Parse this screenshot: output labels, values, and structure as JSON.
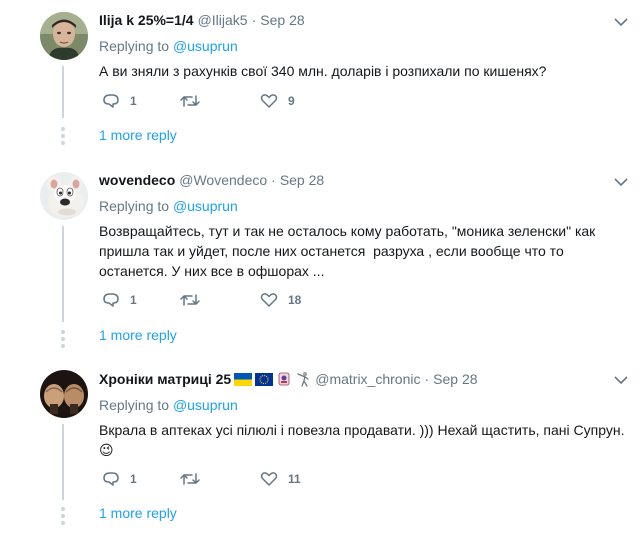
{
  "tweets": [
    {
      "name": "Ilija k 25%=1/4",
      "handle": "@Ilijak5",
      "date": "Sep 28",
      "replying_label": "Replying to",
      "replying_handle": "@usuprun",
      "text": "А ви зняли з рахунків свої 340 млн. доларів і розпихали по кишенях?",
      "replies": "1",
      "retweets": "",
      "likes": "9",
      "more": "1 more reply"
    },
    {
      "name": "wovendeco",
      "handle": "@Wovendeco",
      "date": "Sep 28",
      "replying_label": "Replying to",
      "replying_handle": "@usuprun",
      "text": "Возвращайтесь, тут и так не осталось кому работать, \"моника зеленски\" как пришла так и уйдет, после них останется  разруха , если вообще что то останется. У них все в офшорах ...",
      "replies": "1",
      "retweets": "",
      "likes": "18",
      "more": "1 more reply"
    },
    {
      "name": "Хроніки матриці 25",
      "handle": "@matrix_chronic",
      "date": "Sep 28",
      "replying_label": "Replying to",
      "replying_handle": "@usuprun",
      "text": "Вкрала в аптеках усі пілюлі і повезла продавати. ))) Нехай щастить, пані Супрун. 😉",
      "replies": "1",
      "retweets": "",
      "likes": "11",
      "more": "1 more reply"
    }
  ],
  "separator": "·",
  "colors": {
    "link": "#1da1f2",
    "muted": "#657786",
    "line": "#ccd6dd"
  },
  "icons": [
    "reply-icon",
    "retweet-icon",
    "like-icon",
    "caret-down-icon",
    "ukraine-flag-icon",
    "eu-flag-icon",
    "emblem-icon",
    "fencer-icon"
  ]
}
